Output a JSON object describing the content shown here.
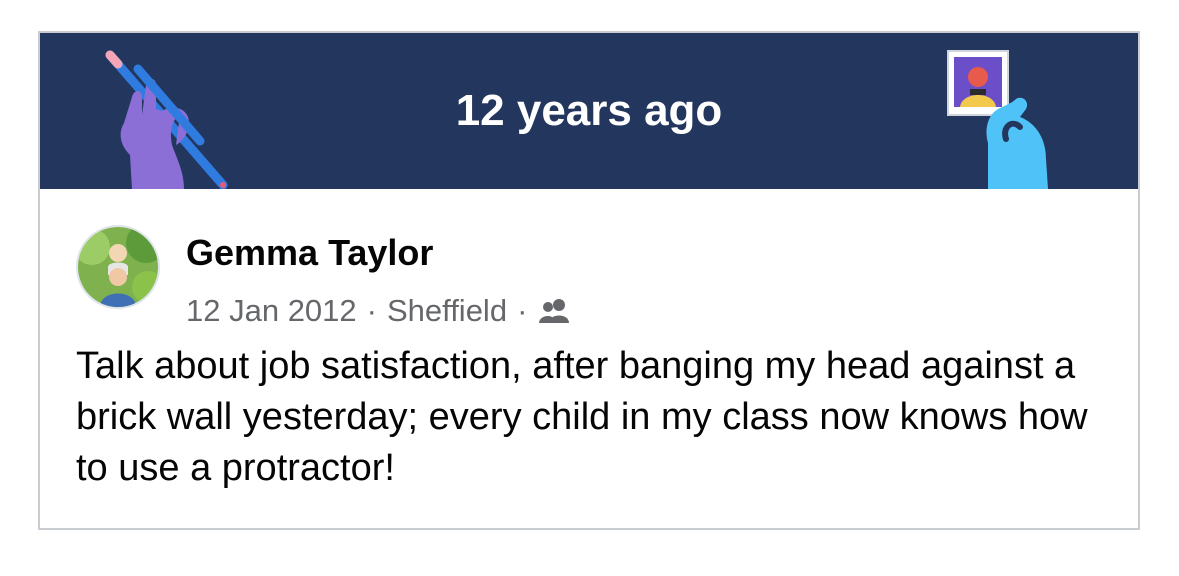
{
  "memory": {
    "title": "12 years ago"
  },
  "post": {
    "author": "Gemma Taylor",
    "date": "12 Jan 2012",
    "separator": "·",
    "location": "Sheffield",
    "audience_icon": "friends-icon",
    "text": "Talk about job satisfaction, after banging my head against a brick wall yesterday; every child in my class now knows how to use a protractor!"
  },
  "colors": {
    "banner_bg": "#22365e",
    "left_hand": "#8b6fd6",
    "right_hand": "#4fc3f7",
    "pencil": "#2f7be0",
    "meta_text": "#65676b"
  }
}
